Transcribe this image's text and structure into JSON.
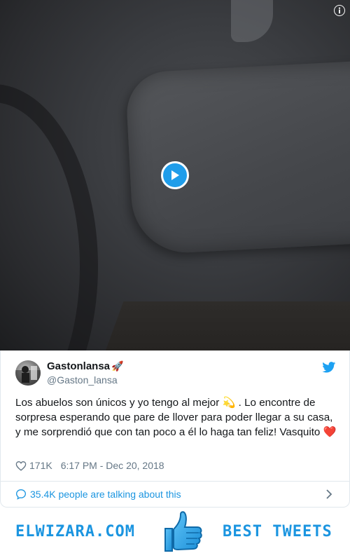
{
  "video": {
    "play_icon": "play-icon",
    "info_icon": "info-icon"
  },
  "tweet": {
    "display_name": "Gastonlansa",
    "name_emoji": "🚀",
    "handle": "@Gaston_lansa",
    "text_part1": "Los abuelos son únicos y yo tengo al mejor ",
    "text_emoji1": "💫",
    "text_part2": " . Lo encontre de sorpresa esperando que pare de llover para poder llegar a su casa, y me sorprendió que con tan poco a él lo haga tan feliz! Vasquito ",
    "text_emoji2": "❤️",
    "like_count": "171K",
    "timestamp": "6:17 PM - Dec 20, 2018",
    "talk_text": "35.4K people are talking about this"
  },
  "banner": {
    "left_text": "ELWIZARA.COM",
    "right_text": "BEST TWEETS",
    "icon": "thumbs-up-icon"
  },
  "colors": {
    "accent": "#1b95e0",
    "text_primary": "#14171a",
    "text_secondary": "#657786",
    "like_heart": "#e0245e",
    "border": "#e1e8ed"
  }
}
